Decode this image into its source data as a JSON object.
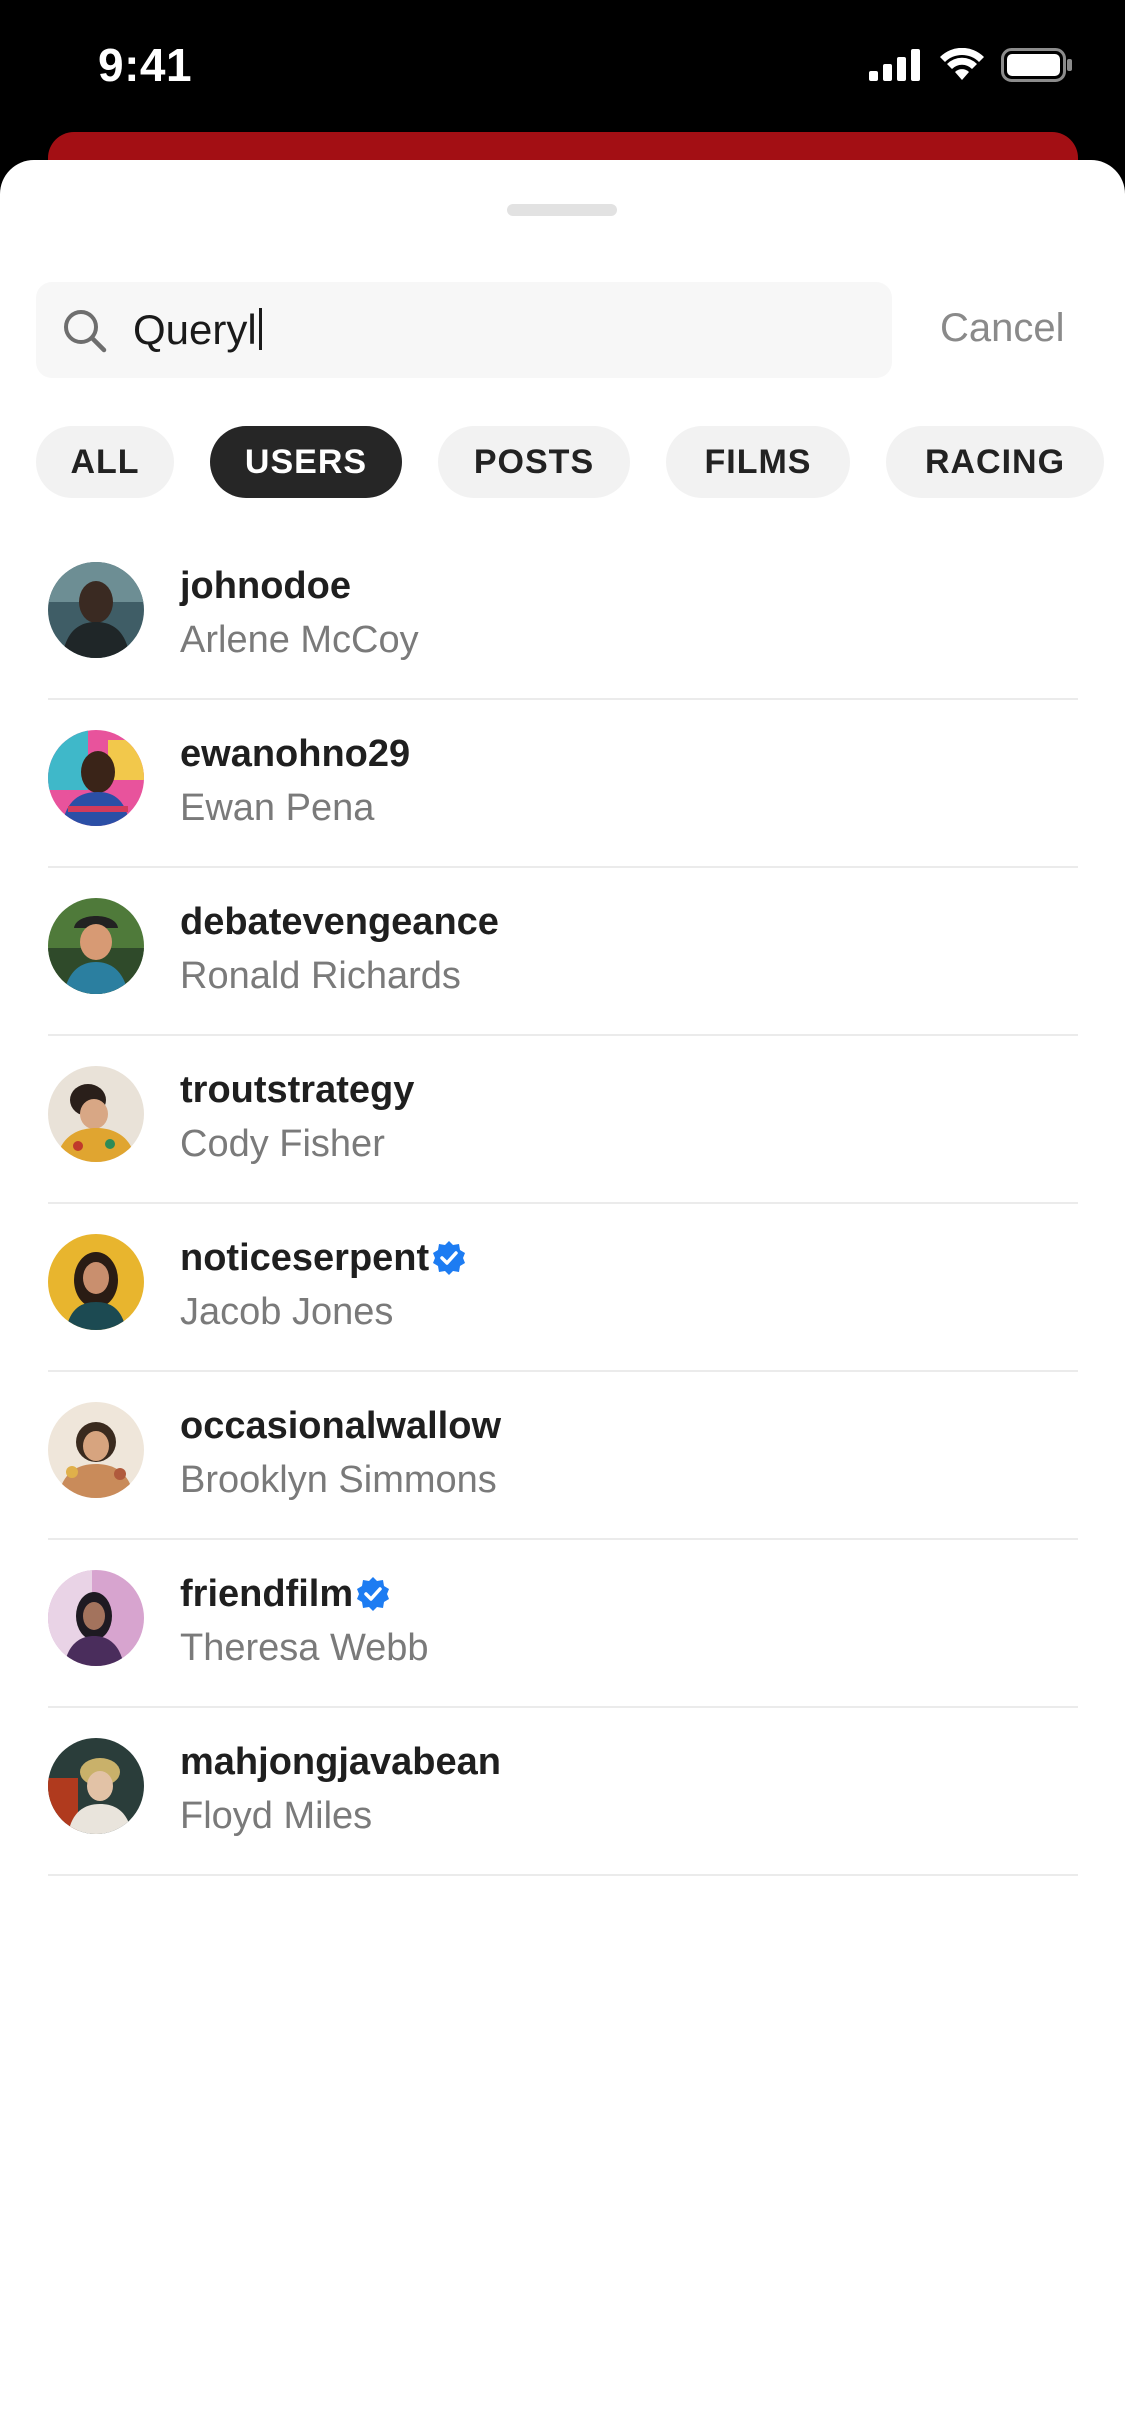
{
  "status_bar": {
    "time": "9:41"
  },
  "search": {
    "value": "Queryl",
    "cancel_label": "Cancel"
  },
  "tabs": [
    {
      "label": "ALL",
      "active": false
    },
    {
      "label": "USERS",
      "active": true
    },
    {
      "label": "POSTS",
      "active": false
    },
    {
      "label": "FILMS",
      "active": false
    },
    {
      "label": "RACING",
      "active": false
    }
  ],
  "users": [
    {
      "username": "johnodoe",
      "name": "Arlene McCoy",
      "verified": false
    },
    {
      "username": "ewanohno29",
      "name": "Ewan Pena",
      "verified": false
    },
    {
      "username": "debatevengeance",
      "name": "Ronald Richards",
      "verified": false
    },
    {
      "username": "troutstrategy",
      "name": "Cody Fisher",
      "verified": false
    },
    {
      "username": "noticeserpent",
      "name": "Jacob Jones",
      "verified": true
    },
    {
      "username": "occasionalwallow",
      "name": "Brooklyn Simmons",
      "verified": false
    },
    {
      "username": "friendfilm",
      "name": "Theresa Webb",
      "verified": true
    },
    {
      "username": "mahjongjavabean",
      "name": "Floyd Miles",
      "verified": false
    }
  ],
  "colors": {
    "accent_red": "#a30f14",
    "active_chip": "#262626",
    "verified_blue": "#1d7cf2"
  },
  "icons": {
    "search": "search-icon",
    "verified": "verified-badge-icon",
    "signal": "cellular-signal-icon",
    "wifi": "wifi-icon",
    "battery": "battery-icon"
  }
}
